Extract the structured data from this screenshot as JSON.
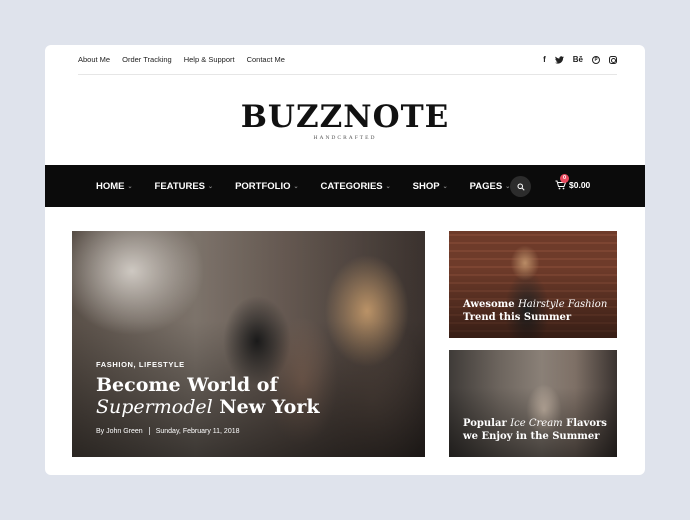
{
  "topbar": {
    "links": [
      "About Me",
      "Order Tracking",
      "Help & Support",
      "Contact Me"
    ],
    "social": [
      {
        "icon": "facebook-icon",
        "glyph": "f"
      },
      {
        "icon": "twitter-icon",
        "glyph": "t"
      },
      {
        "icon": "behance-icon",
        "glyph": "Bē"
      },
      {
        "icon": "pinterest-icon",
        "glyph": "p"
      },
      {
        "icon": "instagram-icon",
        "glyph": ""
      }
    ]
  },
  "brand": {
    "logo": "BUZZNOTE",
    "tagline": "HANDCRAFTED"
  },
  "nav": {
    "items": [
      "HOME",
      "FEATURES",
      "PORTFOLIO",
      "CATEGORIES",
      "SHOP",
      "PAGES"
    ],
    "cart_count": "0",
    "cart_total": "$0.00"
  },
  "hero": {
    "categories": "FASHION, LIFESTYLE",
    "title_line1": "Become World of",
    "title_italic": "Supermodel",
    "title_rest": " New York",
    "author": "By John Green",
    "date": "Sunday, February 11, 2018"
  },
  "side_posts": [
    {
      "pre": "Awesome ",
      "italic": "Hairstyle Fashion",
      "line2": "Trend this Summer"
    },
    {
      "pre": "Popular ",
      "italic": "Ice Cream",
      "post": " Flavors",
      "line2": "we Enjoy in the Summer"
    }
  ],
  "colors": {
    "page_bg": "#dfe3ec",
    "nav_bg": "#0b0b0b",
    "badge": "#e8485c"
  }
}
